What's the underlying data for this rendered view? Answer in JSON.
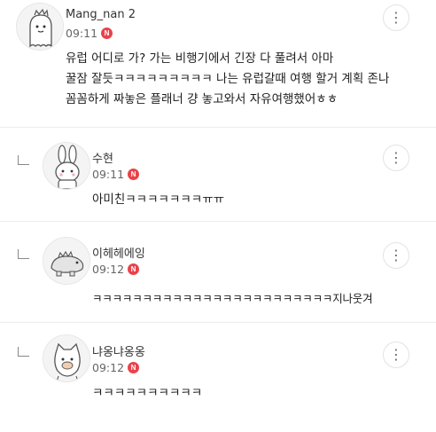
{
  "comments": [
    {
      "author": "Mang_nan 2",
      "time": "09:11",
      "badge": "N",
      "avatar_icon": "ghost-character-icon",
      "lines": [
        "유럽 어디로 가? 가는 비행기에서 긴장 다 풀려서 아마",
        "꿀잠 잘듯ㅋㅋㅋㅋㅋㅋㅋㅋㅋ 나는 유럽갈때 여행 할거 계획 존나",
        "꼼꼼하게 짜놓은 플래너 걍 놓고와서 자유여행했어ㅎㅎ"
      ]
    },
    {
      "author": "수현",
      "time": "09:11",
      "badge": "N",
      "avatar_icon": "rabbit-character-icon",
      "lines": [
        "아미친ㅋㅋㅋㅋㅋㅋㅋㅠㅠ"
      ]
    },
    {
      "author": "이헤헤에잉",
      "time": "09:12",
      "badge": "N",
      "avatar_icon": "dinosaur-character-icon",
      "lines": [
        "ㅋㅋㅋㅋㅋㅋㅋㅋㅋㅋㅋㅋㅋㅋㅋㅋㅋㅋㅋㅋㅋㅋㅋㅋ지나웃겨"
      ]
    },
    {
      "author": "냐옹냐옹옹",
      "time": "09:12",
      "badge": "N",
      "avatar_icon": "cat-character-icon",
      "lines": [
        "ㅋㅋㅋㅋㅋㅋㅋㅋㅋㅋ"
      ]
    }
  ],
  "more_icon": "⋮",
  "colors": {
    "badge": "#e8434a",
    "divider": "#ececec"
  }
}
